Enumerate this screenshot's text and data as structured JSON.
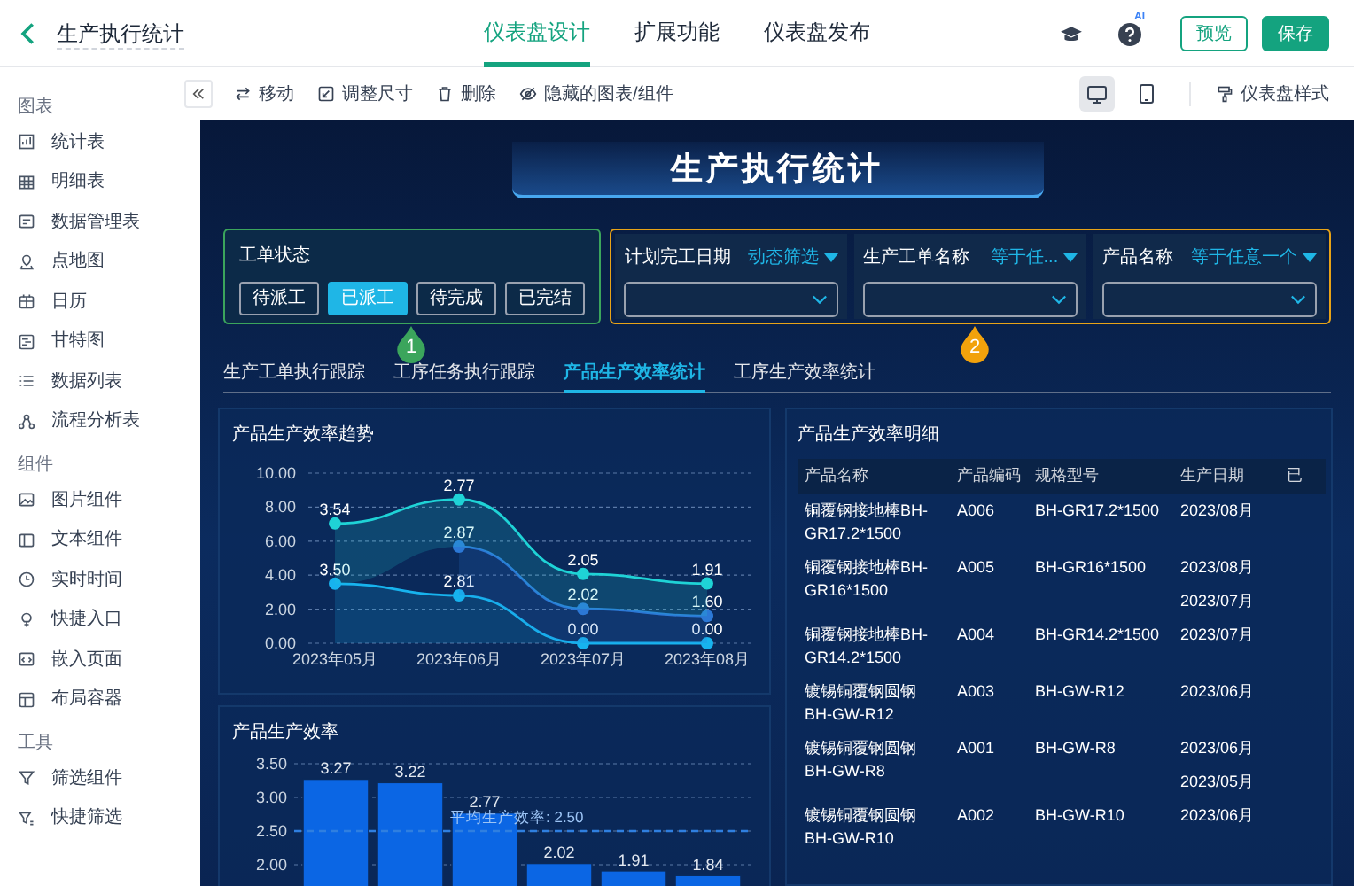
{
  "header": {
    "title": "生产执行统计",
    "tabs": [
      {
        "label": "仪表盘设计",
        "selected": true
      },
      {
        "label": "扩展功能",
        "selected": false
      },
      {
        "label": "仪表盘发布",
        "selected": false
      }
    ],
    "help_badge": "AI",
    "buttons": [
      {
        "label": "预览",
        "kind": "outline"
      },
      {
        "label": "保存",
        "kind": "primary"
      }
    ]
  },
  "sidebar": {
    "sections": [
      {
        "title": "图表",
        "items": [
          {
            "label": "统计表",
            "kind": "stat"
          },
          {
            "label": "明细表",
            "kind": "grid"
          },
          {
            "label": "数据管理表",
            "kind": "form"
          },
          {
            "label": "点地图",
            "kind": "pin"
          },
          {
            "label": "日历",
            "kind": "calendar"
          },
          {
            "label": "甘特图",
            "kind": "gantt"
          },
          {
            "label": "数据列表",
            "kind": "list"
          },
          {
            "label": "流程分析表",
            "kind": "flow"
          }
        ]
      },
      {
        "title": "组件",
        "items": [
          {
            "label": "图片组件",
            "kind": "image"
          },
          {
            "label": "文本组件",
            "kind": "text"
          },
          {
            "label": "实时时间",
            "kind": "clock"
          },
          {
            "label": "快捷入口",
            "kind": "entry"
          },
          {
            "label": "嵌入页面",
            "kind": "embed"
          },
          {
            "label": "布局容器",
            "kind": "layout"
          }
        ]
      },
      {
        "title": "工具",
        "items": [
          {
            "label": "筛选组件",
            "kind": "filter"
          },
          {
            "label": "快捷筛选",
            "kind": "quickfilter"
          }
        ]
      }
    ]
  },
  "toolbar": {
    "actions": [
      {
        "label": "移动",
        "kind": "move"
      },
      {
        "label": "调整尺寸",
        "kind": "resize"
      },
      {
        "label": "删除",
        "kind": "delete"
      },
      {
        "label": "隐藏的图表/组件",
        "kind": "hidden"
      }
    ],
    "views": [
      {
        "kind": "desktop",
        "selected": true
      },
      {
        "kind": "tablet",
        "selected": false
      }
    ],
    "style_button": "仪表盘样式"
  },
  "canvas": {
    "title": "生产执行统计",
    "status_filter": {
      "label": "工单状态",
      "options": [
        {
          "label": "待派工",
          "selected": false
        },
        {
          "label": "已派工",
          "selected": true
        },
        {
          "label": "待完成",
          "selected": false
        },
        {
          "label": "已完结",
          "selected": false
        }
      ]
    },
    "fields": [
      {
        "label": "计划完工日期",
        "mode": "动态筛选"
      },
      {
        "label": "生产工单名称",
        "mode": "等于任..."
      },
      {
        "label": "产品名称",
        "mode": "等于任意一个"
      }
    ],
    "tabs": [
      {
        "label": "生产工单执行跟踪",
        "selected": false
      },
      {
        "label": "工序任务执行跟踪",
        "selected": false
      },
      {
        "label": "产品生产效率统计",
        "selected": true
      },
      {
        "label": "工序生产效率统计",
        "selected": false
      }
    ],
    "markers": [
      {
        "label": "1",
        "color": "#3ba55c"
      },
      {
        "label": "2",
        "color": "#f2a20c"
      }
    ],
    "line_panel": {
      "title": "产品生产效率趋势",
      "chart_data": {
        "type": "area",
        "stacked": true,
        "grid": true,
        "categories": [
          "2023年05月",
          "2023年06月",
          "2023年07月",
          "2023年08月"
        ],
        "ylim": [
          0,
          10
        ],
        "yticks": [
          {
            "value": 0,
            "label": "0.00"
          },
          {
            "value": 2,
            "label": "2.00"
          },
          {
            "value": 4,
            "label": "4.00"
          },
          {
            "value": 6,
            "label": "6.00"
          },
          {
            "value": 8,
            "label": "8.00"
          },
          {
            "value": 10,
            "label": "10.00"
          }
        ],
        "series": [
          {
            "color": "#17b3ee",
            "marker": "circle",
            "values": [
              3.5,
              2.81,
              0.0,
              0.0
            ],
            "value_labels": [
              "3.50",
              "2.81",
              "0.00",
              "0.00"
            ]
          },
          {
            "color": "#2c78d6",
            "marker": "circle",
            "values": [
              null,
              2.87,
              2.02,
              1.6
            ],
            "value_labels": [
              null,
              "2.87",
              "2.02",
              "1.60"
            ]
          },
          {
            "color": "#1fd3d6",
            "marker": "circle",
            "values": [
              3.54,
              2.77,
              2.05,
              1.91
            ],
            "value_labels": [
              "3.54",
              "2.77",
              "2.05",
              "1.91"
            ]
          }
        ]
      }
    },
    "bar_panel": {
      "title": "产品生产效率",
      "chart_data": {
        "type": "bar",
        "grid": true,
        "data_labels": true,
        "ylim": [
          0,
          3.5
        ],
        "yticks": [
          {
            "value": 2,
            "label": "2.00"
          },
          {
            "value": 2.5,
            "label": "2.50"
          },
          {
            "value": 3,
            "label": "3.00"
          },
          {
            "value": 3.5,
            "label": "3.50"
          }
        ],
        "series": [
          {
            "color": "#0b66e4",
            "values": [
              3.27,
              3.22,
              2.77,
              2.02,
              1.91,
              1.84
            ]
          }
        ],
        "ref_lines": [
          {
            "axis": "y",
            "value": 2.5,
            "color": "#2f7fe0",
            "label": "平均生产效率: 2.50"
          }
        ]
      }
    },
    "table": {
      "title": "产品生产效率明细",
      "columns": [
        "产品名称",
        "产品编码",
        "规格型号",
        "生产日期",
        "已"
      ],
      "rows": [
        {
          "name": "铜覆钢接地棒BH-GR17.2*1500",
          "code": "A006",
          "spec": "BH-GR17.2*1500",
          "dates": [
            "2023/08月"
          ]
        },
        {
          "name": "铜覆钢接地棒BH-GR16*1500",
          "code": "A005",
          "spec": "BH-GR16*1500",
          "dates": [
            "2023/08月",
            "2023/07月"
          ]
        },
        {
          "name": "铜覆钢接地棒BH-GR14.2*1500",
          "code": "A004",
          "spec": "BH-GR14.2*1500",
          "dates": [
            "2023/07月"
          ]
        },
        {
          "name": "镀锡铜覆钢圆钢BH-GW-R12",
          "code": "A003",
          "spec": "BH-GW-R12",
          "dates": [
            "2023/06月"
          ]
        },
        {
          "name": "镀锡铜覆钢圆钢BH-GW-R8",
          "code": "A001",
          "spec": "BH-GW-R8",
          "dates": [
            "2023/06月",
            "2023/05月"
          ]
        },
        {
          "name": "镀锡铜覆钢圆钢BH-GW-R10",
          "code": "A002",
          "spec": "BH-GW-R10",
          "dates": [
            "2023/06月"
          ]
        }
      ]
    }
  }
}
